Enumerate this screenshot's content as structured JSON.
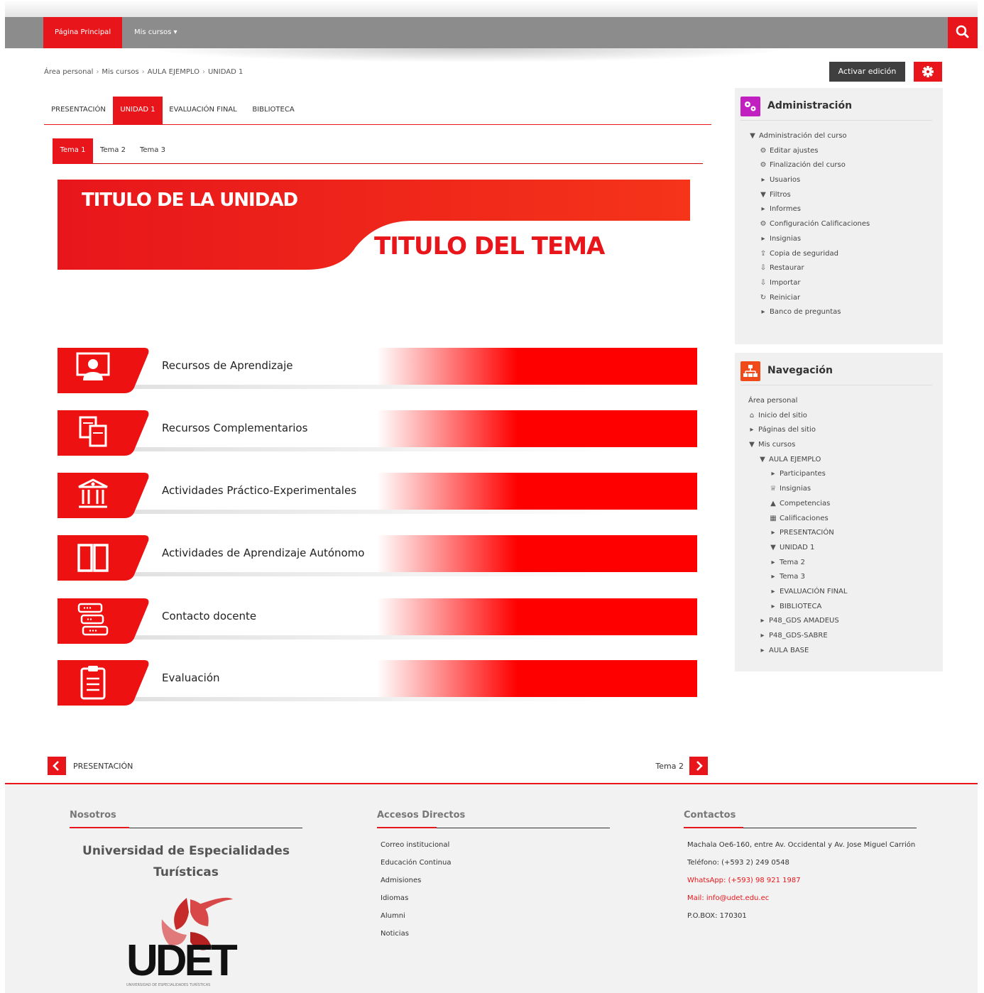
{
  "nav": {
    "home": "Página Principal",
    "courses": "Mis cursos ▾"
  },
  "breadcrumb": [
    "Área personal",
    "Mis cursos",
    "AULA EJEMPLO",
    "UNIDAD 1"
  ],
  "breadcrumb_sep": "›",
  "actions": {
    "edit": "Activar edición"
  },
  "unit_tabs": [
    "PRESENTACIÓN",
    "UNIDAD 1",
    "EVALUACIÓN FINAL",
    "BIBLIOTECA"
  ],
  "topic_tabs": [
    "Tema 1",
    "Tema 2",
    "Tema 3"
  ],
  "banner": {
    "unit_title": "TITULO DE LA UNIDAD",
    "topic_title": "TITULO DEL TEMA"
  },
  "resources": [
    {
      "label": "Recursos de Aprendizaje",
      "icon": "presentation-icon"
    },
    {
      "label": "Recursos Complementarios",
      "icon": "documents-icon"
    },
    {
      "label": "Actividades Práctico-Experimentales",
      "icon": "institution-icon"
    },
    {
      "label": "Actividades de Aprendizaje Autónomo",
      "icon": "open-book-icon"
    },
    {
      "label": "Contacto docente",
      "icon": "chat-icon"
    },
    {
      "label": "Evaluación",
      "icon": "clipboard-icon"
    }
  ],
  "admin": {
    "title": "Administración",
    "items": [
      {
        "label": "Administración del curso",
        "icon": "▼",
        "level": 0
      },
      {
        "label": "Editar ajustes",
        "icon": "⚙",
        "level": 1
      },
      {
        "label": "Finalización del curso",
        "icon": "⚙",
        "level": 1
      },
      {
        "label": "Usuarios",
        "icon": "▸",
        "level": 1
      },
      {
        "label": "Filtros",
        "icon": "▼",
        "level": 1
      },
      {
        "label": "Informes",
        "icon": "▸",
        "level": 1
      },
      {
        "label": "Configuración Calificaciones",
        "icon": "⚙",
        "level": 1
      },
      {
        "label": "Insignias",
        "icon": "▸",
        "level": 1
      },
      {
        "label": "Copia de seguridad",
        "icon": "⇪",
        "level": 1
      },
      {
        "label": "Restaurar",
        "icon": "⇩",
        "level": 1
      },
      {
        "label": "Importar",
        "icon": "⇩",
        "level": 1
      },
      {
        "label": "Reiniciar",
        "icon": "↻",
        "level": 1
      },
      {
        "label": "Banco de preguntas",
        "icon": "▸",
        "level": 1
      }
    ]
  },
  "navigation": {
    "title": "Navegación",
    "items": [
      {
        "label": "Área personal",
        "icon": "",
        "level": 0
      },
      {
        "label": "Inicio del sitio",
        "icon": "⌂",
        "level": 0
      },
      {
        "label": "Páginas del sitio",
        "icon": "▸",
        "level": 0
      },
      {
        "label": "Mis cursos",
        "icon": "▼",
        "level": 0
      },
      {
        "label": "AULA EJEMPLO",
        "icon": "▼",
        "level": 1
      },
      {
        "label": "Participantes",
        "icon": "▸",
        "level": 2
      },
      {
        "label": "Insignias",
        "icon": "♕",
        "level": 2
      },
      {
        "label": "Competencias",
        "icon": "▲",
        "level": 2
      },
      {
        "label": "Calificaciones",
        "icon": "▦",
        "level": 2
      },
      {
        "label": "PRESENTACIÓN",
        "icon": "▸",
        "level": 2
      },
      {
        "label": "UNIDAD 1",
        "icon": "▼",
        "level": 2
      },
      {
        "label": "Tema 2",
        "icon": "▸",
        "level": 2
      },
      {
        "label": "Tema 3",
        "icon": "▸",
        "level": 2
      },
      {
        "label": "EVALUACIÓN FINAL",
        "icon": "▸",
        "level": 2
      },
      {
        "label": "BIBLIOTECA",
        "icon": "▸",
        "level": 2
      },
      {
        "label": "P48_GDS AMADEUS",
        "icon": "▸",
        "level": 1
      },
      {
        "label": "P48_GDS-SABRE",
        "icon": "▸",
        "level": 1
      },
      {
        "label": "AULA BASE",
        "icon": "▸",
        "level": 1
      }
    ]
  },
  "pager": {
    "prev": "PRESENTACIÓN",
    "next": "Tema 2"
  },
  "footer": {
    "about_title": "Nosotros",
    "university": [
      "Universidad de Especialidades",
      "Turísticas"
    ],
    "logo_text": "UDET",
    "logo_sub": "UNIVERSIDAD DE ESPECIALIDADES TURÍSTICAS",
    "links_title": "Accesos Directos",
    "links": [
      "Correo institucional",
      "Educación Continua",
      "Admisiones",
      "Idiomas",
      "Alumni",
      "Noticias"
    ],
    "contact_title": "Contactos",
    "contacts": [
      {
        "text": "Machala Oe6-160, entre Av. Occidental y Av. Jose Miguel Carrión",
        "color": "#333333"
      },
      {
        "text": "Teléfono: (+593 2) 249 0548",
        "color": "#333333"
      },
      {
        "text": "WhatsApp: (+593) 98 921 1987",
        "color": "#e8161b"
      },
      {
        "text": "Mail: info@udet.edu.ec",
        "color": "#e8161b"
      },
      {
        "text": "P.O.BOX: 170301",
        "color": "#333333"
      }
    ]
  },
  "colors": {
    "accent": "#e8161b",
    "topbar": "#8c8c8c",
    "sidebar": "#f0f0f0",
    "admin_icon": "#c21fc0",
    "nav_icon": "#f04a1a"
  }
}
